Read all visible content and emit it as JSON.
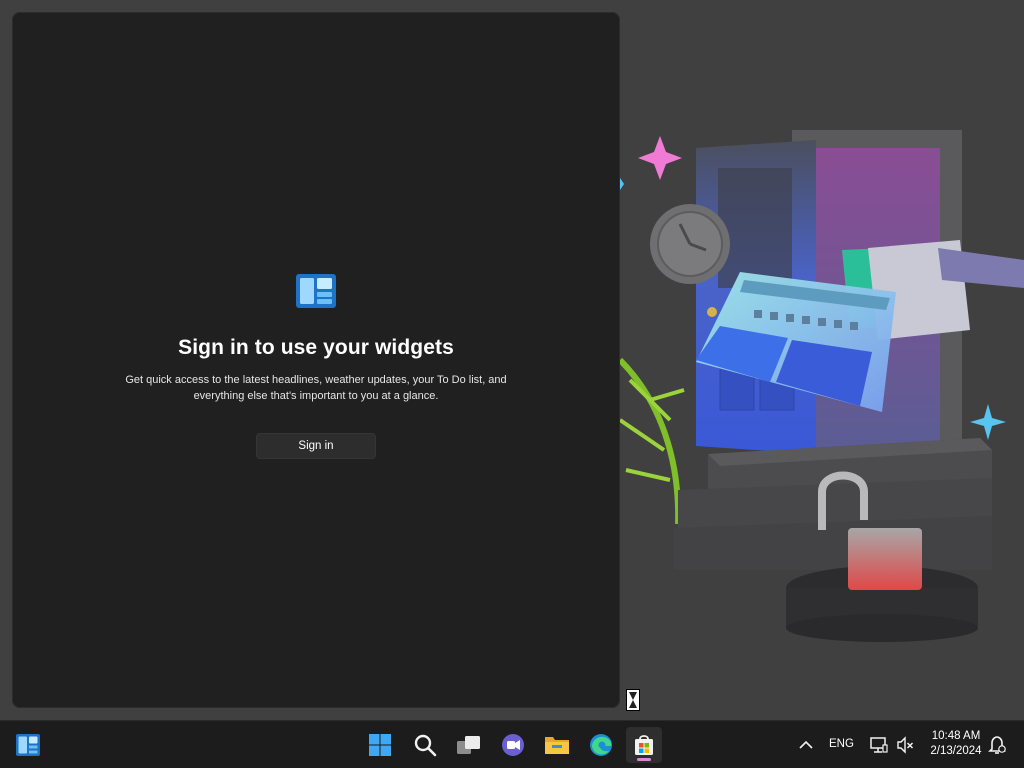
{
  "widgets": {
    "title": "Sign in to use your widgets",
    "description": "Get quick access to the latest headlines, weather updates, your To Do list, and everything else that's important to you at a glance.",
    "signin_label": "Sign in"
  },
  "taskbar": {
    "language": "ENG",
    "time": "10:48 AM",
    "date": "2/13/2024",
    "icons": [
      "widgets-icon",
      "start-icon",
      "search-icon",
      "task-view-icon",
      "chat-icon",
      "file-explorer-icon",
      "edge-icon",
      "store-icon"
    ]
  },
  "colors": {
    "accent": "#4aa3f0",
    "panel_bg": "#202020",
    "desktop_bg": "#404040",
    "taskbar_bg": "#1c1c1c",
    "indicator": "#d58bd0"
  }
}
